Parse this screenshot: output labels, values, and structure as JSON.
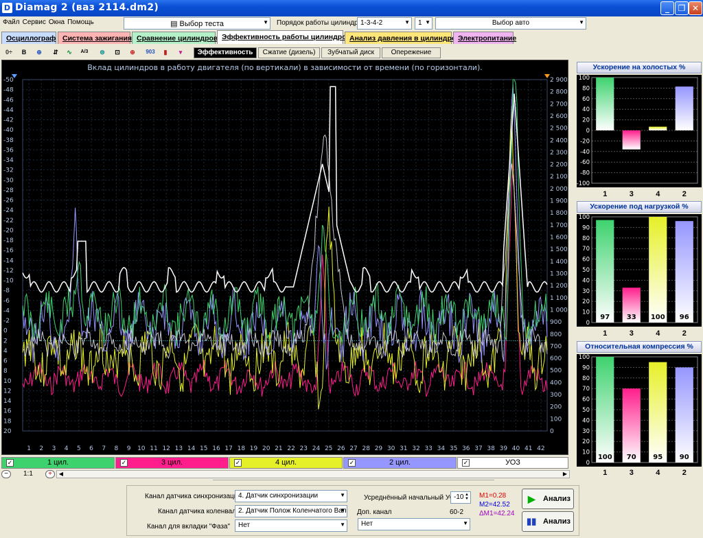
{
  "window": {
    "title": "Diamag 2 (ваз 2114.dm2)",
    "btn_min": "_",
    "btn_max": "❐",
    "btn_close": "✕"
  },
  "menu": [
    "Файл",
    "Сервис",
    "Окна",
    "Помощь"
  ],
  "test_select": {
    "label": "Выбор теста"
  },
  "cylinder_order": {
    "label": "Порядок работы цилиндров",
    "value": "1-3-4-2",
    "num": "1"
  },
  "auto_select": {
    "label": "Выбор авто"
  },
  "tabs": [
    {
      "label": "Осциллограф",
      "bg": "#c8dcff"
    },
    {
      "label": "Система зажигания",
      "bg": "#ffb4b4"
    },
    {
      "label": "Сравнение цилиндров",
      "bg": "#b4f0c8"
    },
    {
      "label": "Эффективность работы цилиндров",
      "bg": "#ffffff"
    },
    {
      "label": "Анализ давления в цилиндре",
      "bg": "#ffe678"
    },
    {
      "label": "Электропитание",
      "bg": "#f0b4f0"
    }
  ],
  "toolbar": [
    "0÷",
    "B",
    "⊕",
    "⇵",
    "∿",
    "A/3",
    "⊜",
    "⊡",
    "⊕",
    "903",
    "▮",
    "▾"
  ],
  "subtabs": [
    "Эффективность",
    "Сжатие (дизель)",
    "Зубчатый диск",
    "Опережение"
  ],
  "main_chart": {
    "title": "Вклад цилиндров в работу двигателя (по вертикали) в зависимости от времени (по горизонтали).",
    "left_ticks": [
      "-50",
      "-48",
      "-46",
      "-44",
      "-42",
      "-40",
      "-38",
      "-36",
      "-34",
      "-32",
      "-30",
      "-28",
      "-26",
      "-24",
      "-22",
      "-20",
      "-18",
      "-16",
      "-14",
      "-12",
      "-10",
      "-8",
      "-6",
      "-4",
      "-2",
      "0",
      "2",
      "4",
      "6",
      "8",
      "10",
      "12",
      "14",
      "16",
      "18",
      "20"
    ],
    "right_ticks": [
      "2 900",
      "2 800",
      "2 700",
      "2 600",
      "2 500",
      "2 400",
      "2 300",
      "2 200",
      "2 100",
      "2 000",
      "1 900",
      "1 800",
      "1 700",
      "1 600",
      "1 500",
      "1 400",
      "1 300",
      "1 200",
      "1 100",
      "1 000",
      "900",
      "800",
      "700",
      "600",
      "500",
      "400",
      "300",
      "200",
      "100",
      "0"
    ],
    "x_ticks": [
      "1",
      "2",
      "3",
      "4",
      "5",
      "6",
      "7",
      "8",
      "9",
      "10",
      "11",
      "12",
      "13",
      "14",
      "15",
      "16",
      "17",
      "18",
      "19",
      "20",
      "21",
      "22",
      "23",
      "24",
      "25",
      "26",
      "27",
      "28",
      "29",
      "30",
      "31",
      "32",
      "33",
      "34",
      "35",
      "36",
      "37",
      "38",
      "39",
      "40",
      "41",
      "42"
    ]
  },
  "chart_data": [
    {
      "type": "bar",
      "title": "Ускорение на холостых %",
      "categories": [
        "1",
        "3",
        "4",
        "2"
      ],
      "values": [
        100,
        -36,
        7,
        83
      ],
      "ylim": [
        -100,
        100
      ],
      "colors": [
        "#3ed26e",
        "#ff1e8c",
        "#e6f028",
        "#9696ff"
      ],
      "data_labels": [
        "",
        "",
        "",
        ""
      ]
    },
    {
      "type": "bar",
      "title": "Ускорение под нагрузкой %",
      "categories": [
        "1",
        "3",
        "4",
        "2"
      ],
      "values": [
        97,
        33,
        100,
        96
      ],
      "ylim": [
        0,
        100
      ],
      "colors": [
        "#3ed26e",
        "#ff1e8c",
        "#e6f028",
        "#9696ff"
      ],
      "data_labels": [
        "97",
        "33",
        "100",
        "96"
      ]
    },
    {
      "type": "bar",
      "title": "Относительная компрессия %",
      "categories": [
        "1",
        "3",
        "4",
        "2"
      ],
      "values": [
        100,
        70,
        95,
        90
      ],
      "ylim": [
        0,
        100
      ],
      "colors": [
        "#3ed26e",
        "#ff1e8c",
        "#e6f028",
        "#9696ff"
      ],
      "data_labels": [
        "100",
        "70",
        "95",
        "90"
      ]
    }
  ],
  "channels": [
    {
      "label": "1 цил.",
      "bg": "#3ed26e"
    },
    {
      "label": "3 цил.",
      "bg": "#ff1e8c"
    },
    {
      "label": "4 цил.",
      "bg": "#e6f028"
    },
    {
      "label": "2 цил.",
      "bg": "#9696ff"
    },
    {
      "label": "УОЗ",
      "bg": "#ffffff"
    }
  ],
  "zoom": "1:1",
  "bottom": {
    "sync_label": "Канал датчика синхронизации",
    "sync_value": "4.  Датчик синхронизации",
    "crank_label": "Канал датчика коленвала",
    "crank_value": "2.  Датчик Полож Коленчатого Вал",
    "phase_label": "Канал для вкладки \"Фаза\"",
    "phase_value": "Нет",
    "uoz_label": "Усреднённый начальный УОЗ",
    "uoz_value": "-10",
    "dop_label": "Доп. канал",
    "dop_extra": "60-2",
    "dop_value": "Нет",
    "m1": "M1=0.28",
    "m2": "M2=42.52",
    "dm": "ΔM1=42.24",
    "analyze1": "Анализ",
    "analyze2": "Анализ"
  }
}
